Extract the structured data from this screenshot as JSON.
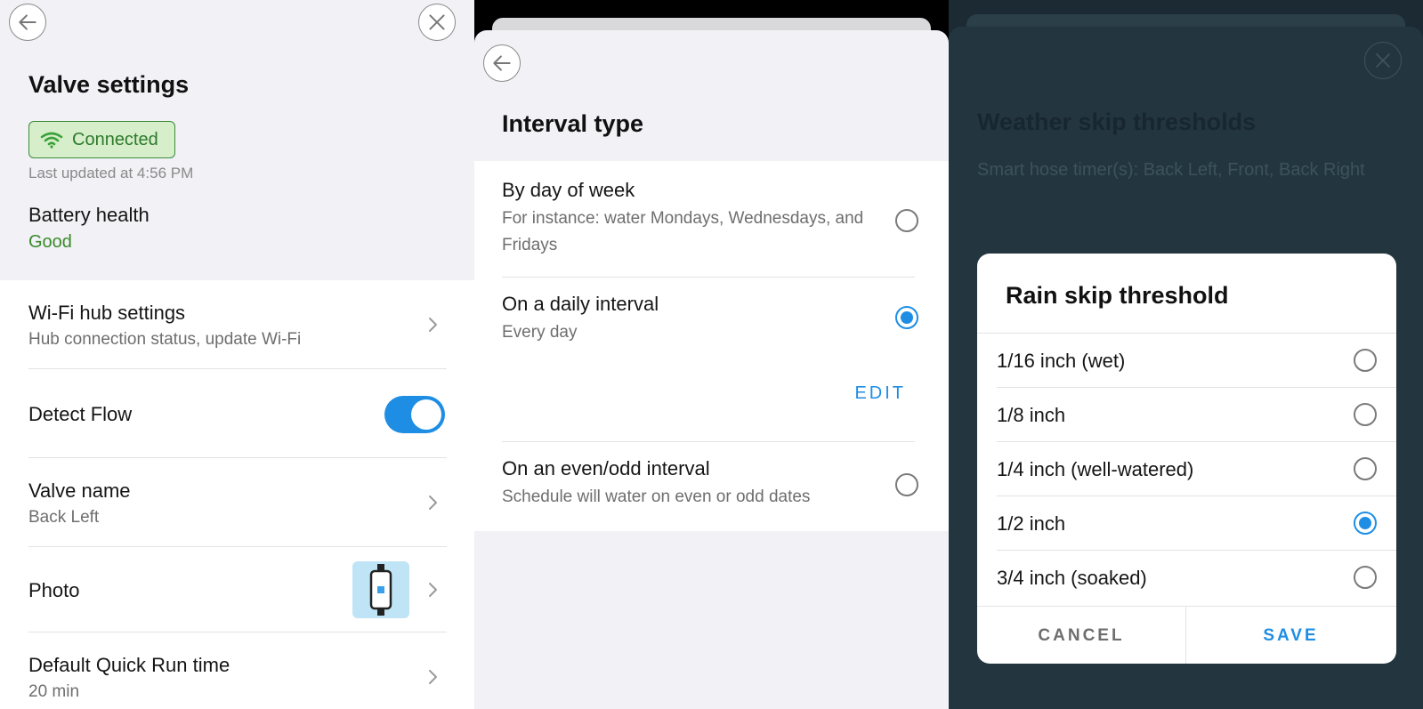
{
  "panel1": {
    "title": "Valve settings",
    "connection_badge": "Connected",
    "last_updated": "Last updated at 4:56 PM",
    "battery_label": "Battery health",
    "battery_value": "Good",
    "rows": {
      "wifi_hub": {
        "label": "Wi-Fi hub settings",
        "sub": "Hub connection status, update Wi-Fi"
      },
      "detect_flow": {
        "label": "Detect Flow",
        "toggle_on": true
      },
      "valve_name": {
        "label": "Valve name",
        "sub": "Back Left"
      },
      "photo": {
        "label": "Photo"
      },
      "quick_run": {
        "label": "Default Quick Run time",
        "sub": "20 min"
      }
    }
  },
  "panel2": {
    "title": "Interval type",
    "options": [
      {
        "label": "By day of week",
        "sub": "For instance: water Mondays, Wednesdays, and Fridays",
        "selected": false
      },
      {
        "label": "On a daily interval",
        "sub": "Every day",
        "selected": true
      },
      {
        "label": "On an even/odd interval",
        "sub": "Schedule will water on even or odd dates",
        "selected": false
      }
    ],
    "edit_label": "EDIT"
  },
  "panel3": {
    "title": "Weather skip thresholds",
    "subtitle": "Smart hose timer(s): Back Left, Front, Back Right",
    "dialog": {
      "title": "Rain skip threshold",
      "options": [
        {
          "label": "1/16 inch (wet)",
          "selected": false
        },
        {
          "label": "1/8 inch",
          "selected": false
        },
        {
          "label": "1/4 inch (well-watered)",
          "selected": false
        },
        {
          "label": "1/2 inch",
          "selected": true
        },
        {
          "label": "3/4 inch (soaked)",
          "selected": false
        }
      ],
      "cancel_label": "CANCEL",
      "save_label": "SAVE"
    }
  },
  "colors": {
    "accent": "#1e8ee5",
    "connected_green": "#2d7a2d",
    "good_green": "#3a8a2a"
  }
}
